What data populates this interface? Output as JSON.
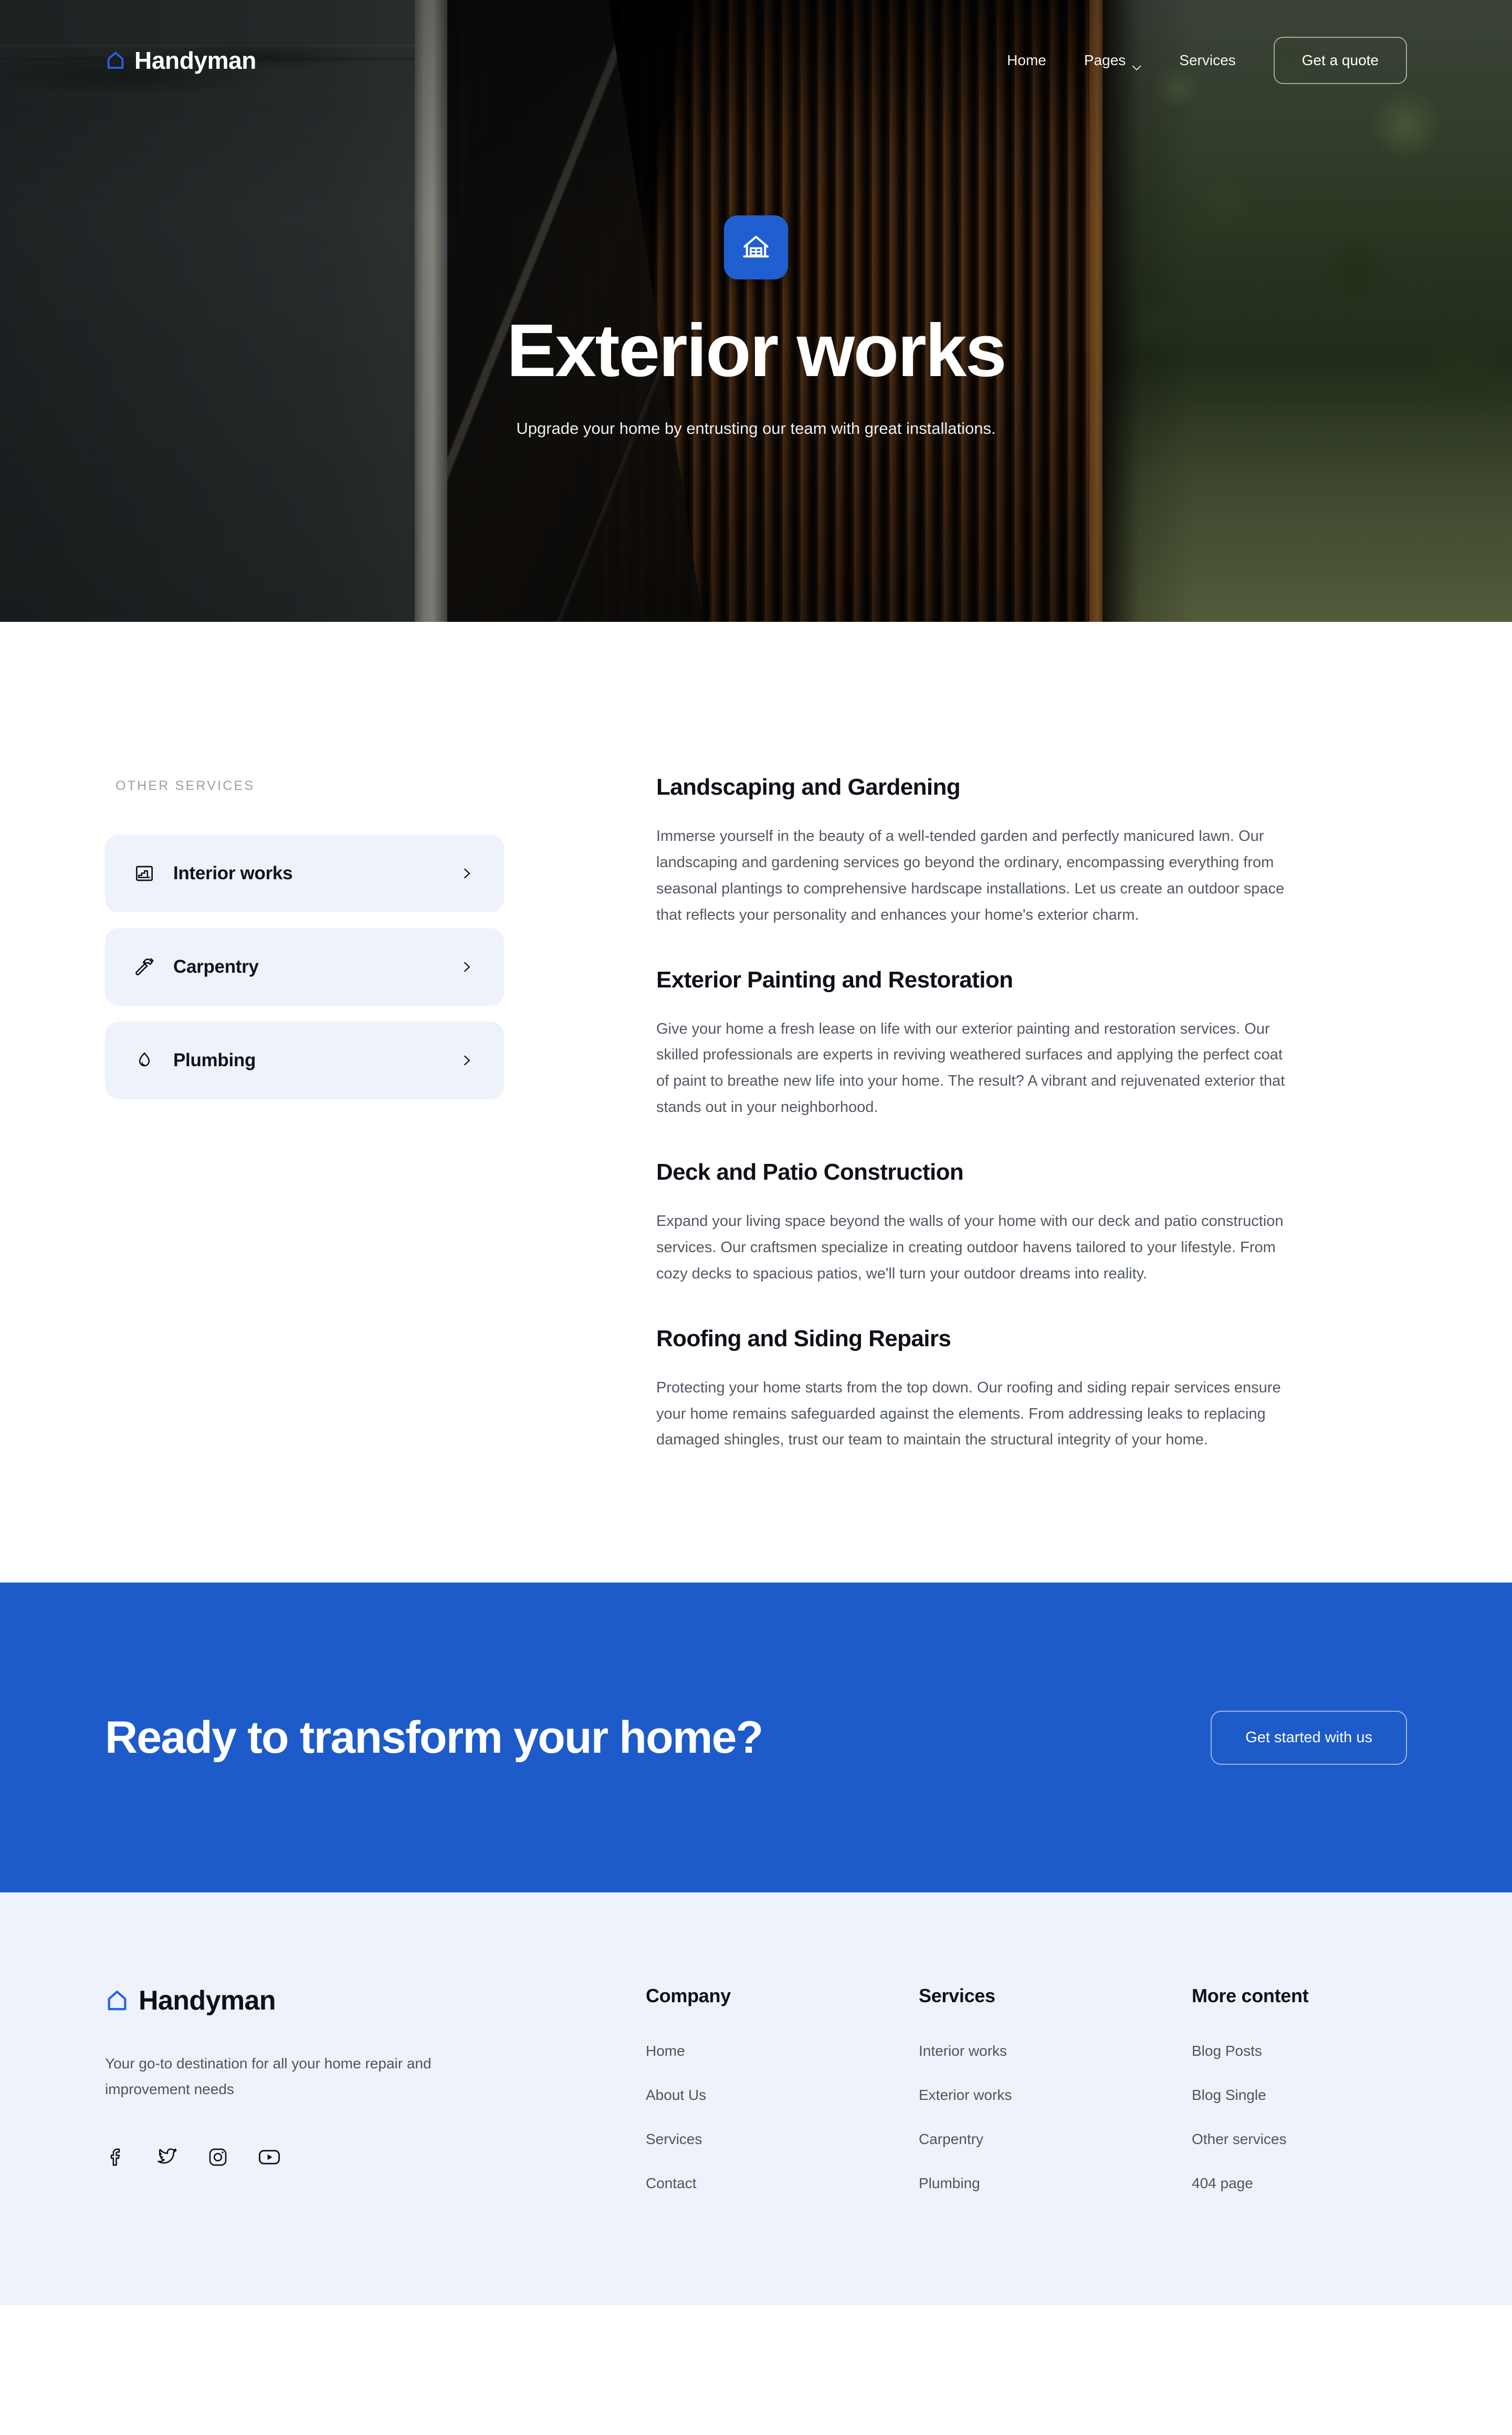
{
  "brand": {
    "name": "Handyman",
    "logo_icon": "house-outline-icon",
    "accent_color": "#1c5bc9"
  },
  "nav": {
    "items": [
      {
        "label": "Home",
        "has_caret": false
      },
      {
        "label": "Pages",
        "has_caret": true
      },
      {
        "label": "Services",
        "has_caret": false
      }
    ],
    "cta_label": "Get a quote"
  },
  "hero": {
    "badge_icon": "house-garage-icon",
    "title": "Exterior works",
    "subtitle": "Upgrade your home by entrusting our team with great installations."
  },
  "sidebar": {
    "label": "OTHER SERVICES",
    "items": [
      {
        "label": "Interior works",
        "icon": "stairs-icon",
        "arrow": "chevron-right-icon"
      },
      {
        "label": "Carpentry",
        "icon": "hammer-icon",
        "arrow": "chevron-right-icon"
      },
      {
        "label": "Plumbing",
        "icon": "water-drop-icon",
        "arrow": "chevron-right-icon"
      }
    ]
  },
  "sections": [
    {
      "title": "Landscaping and Gardening",
      "body": "Immerse yourself in the beauty of a well-tended garden and perfectly manicured lawn. Our landscaping and gardening services go beyond the ordinary, encompassing everything from seasonal plantings to comprehensive hardscape installations. Let us create an outdoor space that reflects your personality and enhances your home's exterior charm."
    },
    {
      "title": "Exterior Painting and Restoration",
      "body": "Give your home a fresh lease on life with our exterior painting and restoration services. Our skilled professionals are experts in reviving weathered surfaces and applying the perfect coat of paint to breathe new life into your home. The result? A vibrant and rejuvenated exterior that stands out in your neighborhood."
    },
    {
      "title": "Deck and Patio Construction",
      "body": "Expand your living space beyond the walls of your home with our deck and patio construction services. Our craftsmen specialize in creating outdoor havens tailored to your lifestyle. From cozy decks to spacious patios, we'll turn your outdoor dreams into reality."
    },
    {
      "title": "Roofing and Siding Repairs",
      "body": "Protecting your home starts from the top down. Our roofing and siding repair services ensure your home remains safeguarded against the elements. From addressing leaks to replacing damaged shingles, trust our team to maintain the structural integrity of your home."
    }
  ],
  "cta": {
    "title": "Ready to transform your home?",
    "button_label": "Get started with us",
    "background_color": "#1c5bc9"
  },
  "footer": {
    "brand_name": "Handyman",
    "tagline": "Your go-to destination for all your home repair and improvement needs",
    "social": [
      {
        "name": "facebook-icon"
      },
      {
        "name": "twitter-icon"
      },
      {
        "name": "instagram-icon"
      },
      {
        "name": "youtube-icon"
      }
    ],
    "columns": [
      {
        "title": "Company",
        "links": [
          "Home",
          "About Us",
          "Services",
          "Contact"
        ]
      },
      {
        "title": "Services",
        "links": [
          "Interior works",
          "Exterior works",
          "Carpentry",
          "Plumbing"
        ]
      },
      {
        "title": "More content",
        "links": [
          "Blog Posts",
          "Blog Single",
          "Other services",
          "404 page"
        ]
      }
    ]
  }
}
